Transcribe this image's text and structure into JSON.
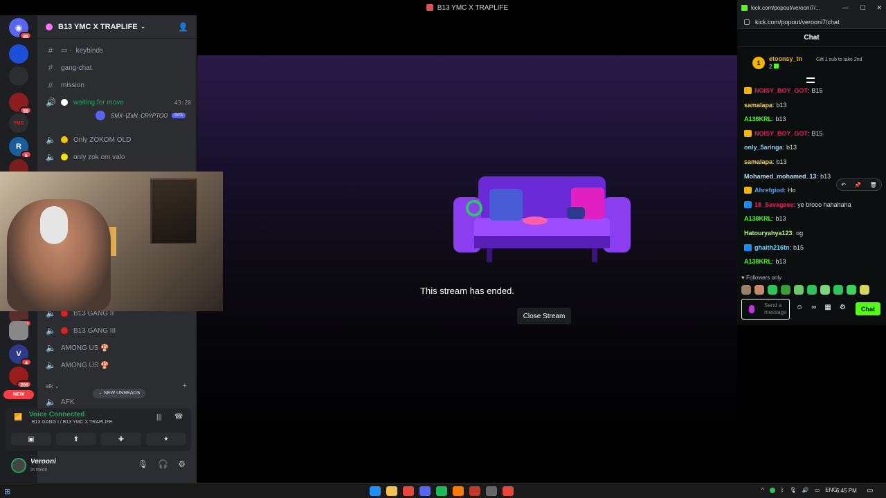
{
  "window": {
    "title": "B13 YMC X TRAPLIFE"
  },
  "servers": [
    {
      "id": "discord-home",
      "badge": "95",
      "color": "#5865f2"
    },
    {
      "id": "among-us",
      "badge": "",
      "color": "#1d4fd8"
    },
    {
      "id": "server-3",
      "badge": "",
      "color": "#2b2d31"
    },
    {
      "id": "server-4",
      "badge": "58",
      "color": "#8b1e1e"
    },
    {
      "id": "ymc",
      "badge": "",
      "color": "#2b2d31",
      "label": "YMC"
    },
    {
      "id": "server-6",
      "badge": "6",
      "color": "#1a5d9a",
      "label": "R"
    },
    {
      "id": "server-7",
      "badge": "",
      "color": "#7a1d1d"
    }
  ],
  "servers_lower": [
    {
      "id": "server-8",
      "badge": "28",
      "color": "#5a2d2d"
    },
    {
      "id": "server-9",
      "badge": "",
      "color": "#888888"
    },
    {
      "id": "server-10",
      "badge": "4",
      "color": "#2e3a8c",
      "label": "V"
    },
    {
      "id": "server-11",
      "badge": "205",
      "color": "#9a1c1c"
    }
  ],
  "new_label": "NEW",
  "server_header": {
    "name": "B13 YMC X TRAPLIFE"
  },
  "channels": [
    {
      "name": "keybinds",
      "prefix": "▭ ·"
    },
    {
      "name": "gang-chat",
      "prefix": ""
    },
    {
      "name": "mission",
      "prefix": ""
    }
  ],
  "voice_channels": [
    {
      "name": "waiting for move",
      "timer": "43:20",
      "dot": "#ffffff",
      "active": true
    },
    {
      "name": "Only ZOKOM OLD",
      "dot": "#f5c400"
    },
    {
      "name": "only zok om valo",
      "dot": "#f5e400"
    }
  ],
  "voice_member": {
    "name": "SMX⁻|ZaN_CRYPTOO",
    "tag": "GTA"
  },
  "voice_channels_lower": [
    {
      "name": "B13 GANG II",
      "dot": "#e02020"
    },
    {
      "name": "B13 GANG III",
      "dot": "#e02020"
    },
    {
      "name": "AMONG US 🍄",
      "dot": ""
    },
    {
      "name": "AMONG US 🍄",
      "dot": ""
    }
  ],
  "category": "afk",
  "afk_channel": "AFK",
  "new_unreads": "NEW UNREADS",
  "voice_status": {
    "title": "Voice Connected",
    "subtitle": "B13 GANG I / B13 YMC X TRAPLIFE"
  },
  "user": {
    "name": "Verooni",
    "status": "In voice"
  },
  "stream": {
    "ended_message": "This stream has ended.",
    "close_label": "Close Stream"
  },
  "popout": {
    "tab_title": "kick.com/popout/verooni7/...",
    "url": "kick.com/popout/verooni7/chat",
    "header": "Chat",
    "leader": {
      "rank": "1",
      "name": "etoonsy_tn",
      "count": "2",
      "gift_text": "Gift 1 sub to take 2nd"
    },
    "messages": [
      {
        "user": "NOISY_BOY_GOT",
        "text": "B15",
        "color": "#e0245e",
        "badge": "#f5b400"
      },
      {
        "user": "samalapa",
        "text": "b13",
        "color": "#f5d76e",
        "badge": ""
      },
      {
        "user": "A138KRL",
        "text": "b13",
        "color": "#53fc18",
        "badge": ""
      },
      {
        "user": "NOISY_BOY_GOT",
        "text": "B15",
        "color": "#e0245e",
        "badge": "#f5b400"
      },
      {
        "user": "only_5aringa",
        "text": "b13",
        "color": "#7fd4ff",
        "badge": ""
      },
      {
        "user": "samalapa",
        "text": "b13",
        "color": "#f5d76e",
        "badge": ""
      },
      {
        "user": "Mohamed_mohamed_13",
        "text": "b13",
        "color": "#b2e3ff",
        "badge": ""
      },
      {
        "user": "Ahrefgiod",
        "text": "Ho",
        "color": "#4aa3ff",
        "badge": "#f5b400"
      },
      {
        "user": "18_Savageee",
        "text": "ye brooo hahahaha",
        "color": "#e0245e",
        "badge": "#1a8cff"
      },
      {
        "user": "A138KRL",
        "text": "b13",
        "color": "#53fc18",
        "badge": ""
      },
      {
        "user": "Hatouryahya123",
        "text": "og",
        "color": "#b6ff7a",
        "badge": ""
      },
      {
        "user": "ghaith216tn",
        "text": "b15",
        "color": "#7fd4ff",
        "badge": "#1a8cff"
      },
      {
        "user": "A138KRL",
        "text": "b13",
        "color": "#53fc18",
        "badge": ""
      }
    ],
    "followers_only": "Followers only",
    "input_placeholder": "Send a message",
    "send_label": "Chat"
  },
  "taskbar": {
    "language": "ENG",
    "time": "6:45 PM"
  }
}
